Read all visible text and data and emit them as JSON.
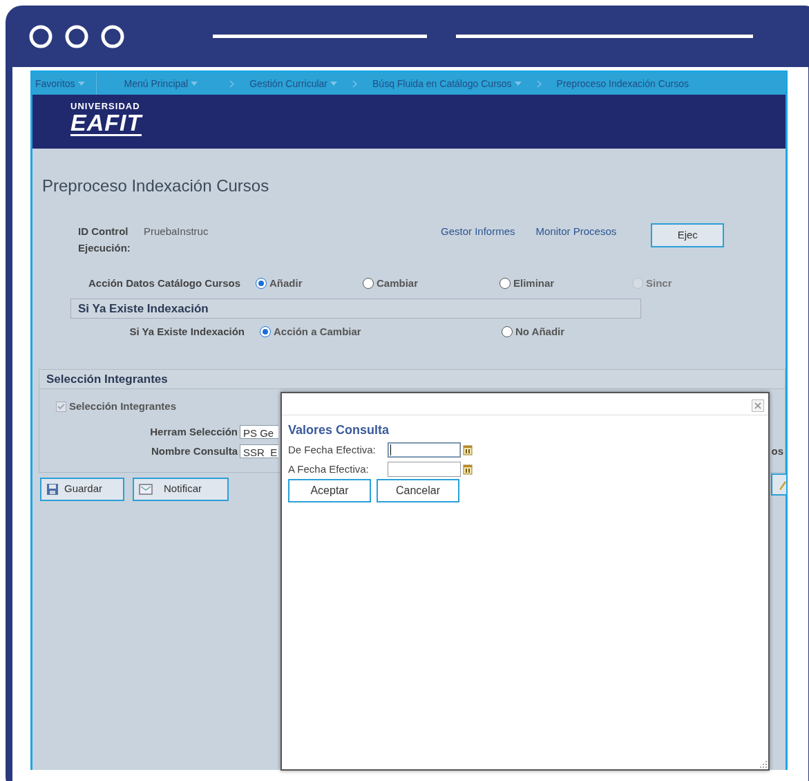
{
  "breadcrumbs": [
    {
      "label": "Favoritos",
      "dropdown": true
    },
    {
      "label": "Menú Principal",
      "dropdown": true
    },
    {
      "label": "Gestión Curricular",
      "dropdown": true
    },
    {
      "label": "Búsq Fluida en Catálogo Cursos",
      "dropdown": true
    },
    {
      "label": "Preproceso Indexación Cursos",
      "dropdown": false
    }
  ],
  "logo": {
    "line1": "UNIVERSIDAD",
    "line2": "EAFIT"
  },
  "title": "Preproceso Indexación Cursos",
  "run_control": {
    "label": "ID Control Ejecución:",
    "value": "PruebaInstruc",
    "links": [
      "Gestor Informes",
      "Monitor Procesos"
    ],
    "button": "Ejec"
  },
  "catalog_action": {
    "label": "Acción Datos Catálogo Cursos",
    "options": [
      {
        "label": "Añadir",
        "selected": true,
        "disabled": false
      },
      {
        "label": "Cambiar",
        "selected": false,
        "disabled": false
      },
      {
        "label": "Eliminar",
        "selected": false,
        "disabled": false
      },
      {
        "label": "Sincr",
        "selected": false,
        "disabled": true
      }
    ]
  },
  "existing_index": {
    "header": "Si Ya Existe Indexación",
    "label": "Si Ya Existe Indexación",
    "options": [
      {
        "label": "Acción a Cambiar",
        "selected": true
      },
      {
        "label": "No Añadir",
        "selected": false
      }
    ]
  },
  "member_selection": {
    "header": "Selección Integrantes",
    "checkbox": {
      "label": "Selección Integrantes",
      "checked": true,
      "disabled": true
    },
    "fields": [
      {
        "label": "Herram Selección",
        "value": "PS Ge"
      },
      {
        "label": "Nombre Consulta",
        "value": "SSR_E"
      }
    ],
    "clipped_text": "os"
  },
  "buttons": [
    {
      "label": "Guardar",
      "kind": "save"
    },
    {
      "label": "Notificar",
      "kind": "notify"
    }
  ],
  "dialog": {
    "title": "Valores Consulta",
    "fields": [
      {
        "label": "De Fecha Efectiva:",
        "focused": true
      },
      {
        "label": "A Fecha Efectiva:",
        "focused": false
      }
    ],
    "buttons": [
      "Aceptar",
      "Cancelar"
    ]
  }
}
